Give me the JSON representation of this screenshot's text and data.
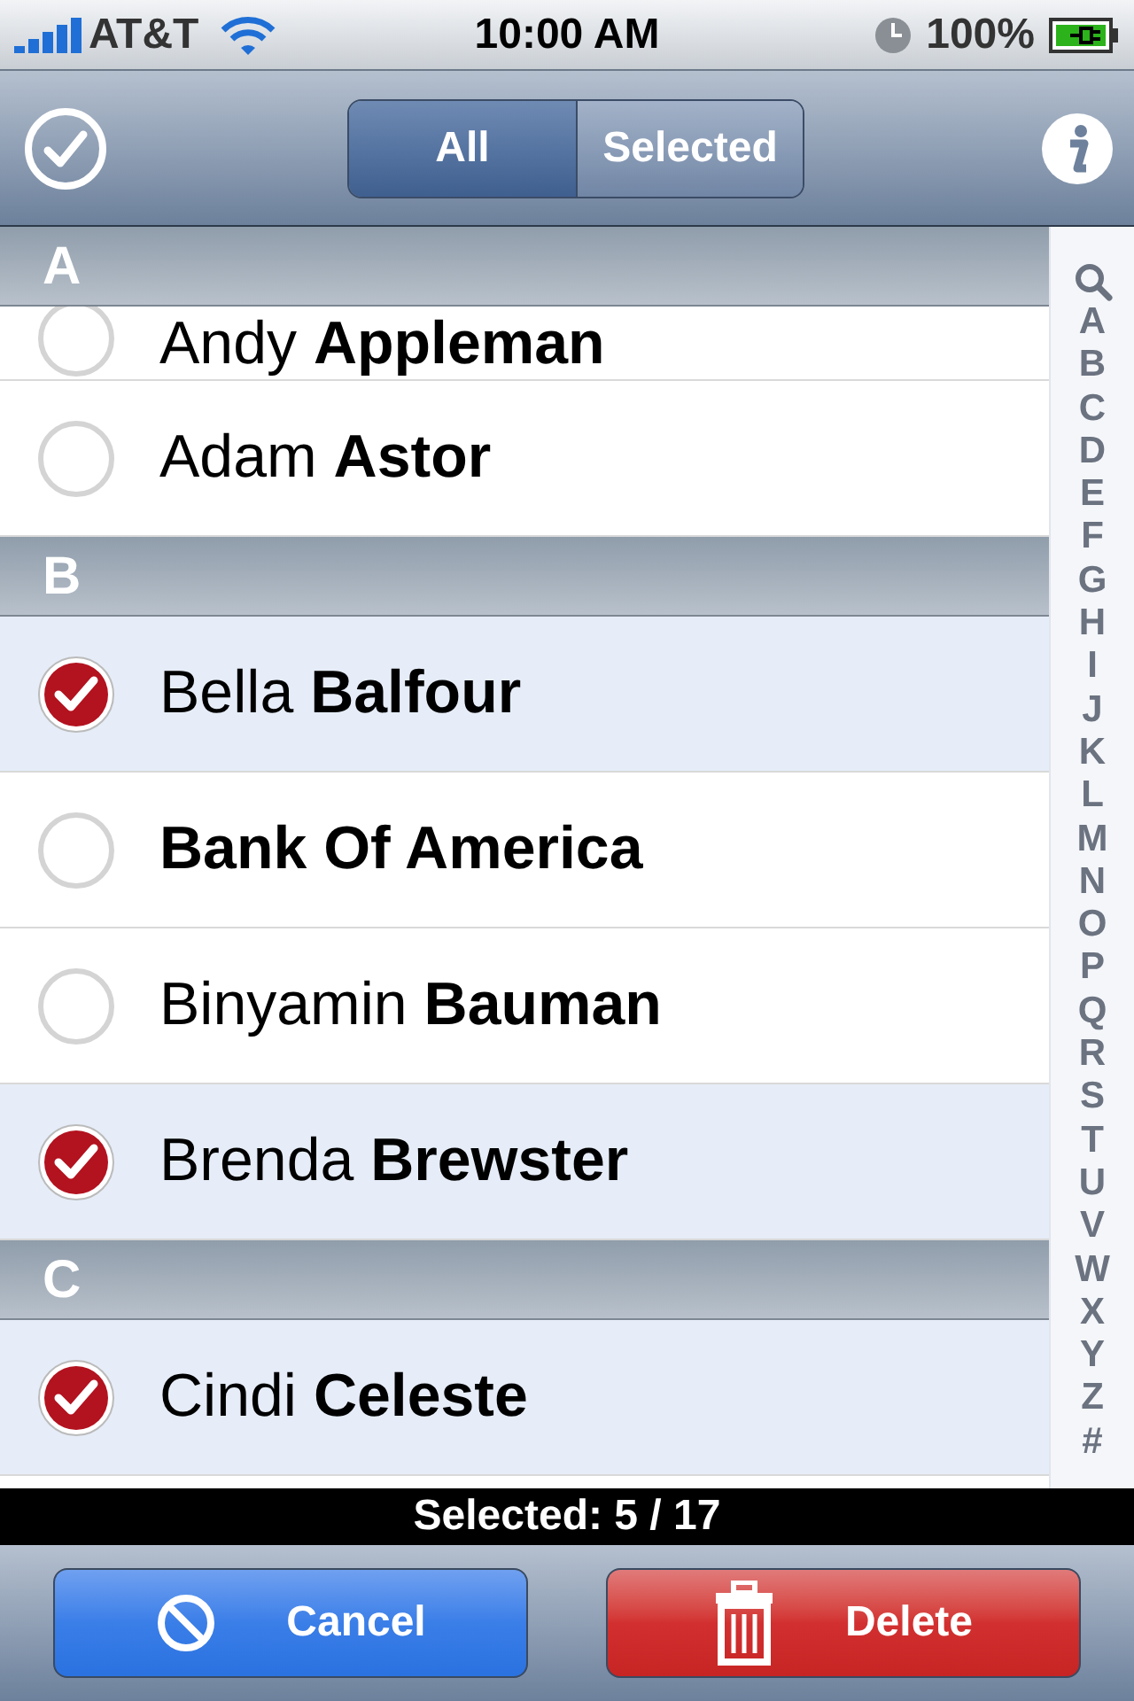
{
  "status_bar": {
    "carrier": "AT&T",
    "time": "10:00 AM",
    "battery": "100%"
  },
  "nav_bar": {
    "segments": [
      {
        "label": "All",
        "selected": true
      },
      {
        "label": "Selected",
        "selected": false
      }
    ]
  },
  "sections": [
    {
      "header": "A",
      "rows": [
        {
          "kind": "person",
          "first_name": "Andy",
          "last_name": "Appleman",
          "checked": false,
          "partial": true
        },
        {
          "kind": "person",
          "first_name": "Adam",
          "last_name": "Astor",
          "checked": false
        }
      ]
    },
    {
      "header": "B",
      "rows": [
        {
          "kind": "person",
          "first_name": "Bella",
          "last_name": "Balfour",
          "checked": true
        },
        {
          "kind": "company",
          "name": "Bank Of America",
          "checked": false
        },
        {
          "kind": "person",
          "first_name": "Binyamin",
          "last_name": "Bauman",
          "checked": false
        },
        {
          "kind": "person",
          "first_name": "Brenda",
          "last_name": "Brewster",
          "checked": true
        }
      ]
    },
    {
      "header": "C",
      "rows": [
        {
          "kind": "person",
          "first_name": "Cindi",
          "last_name": "Celeste",
          "checked": true
        }
      ]
    }
  ],
  "index": [
    "A",
    "B",
    "C",
    "D",
    "E",
    "F",
    "G",
    "H",
    "I",
    "J",
    "K",
    "L",
    "M",
    "N",
    "O",
    "P",
    "Q",
    "R",
    "S",
    "T",
    "U",
    "V",
    "W",
    "X",
    "Y",
    "Z",
    "#"
  ],
  "counter": "Selected: 5 / 17",
  "buttons": [
    {
      "kind": "cancel",
      "label": "Cancel"
    },
    {
      "kind": "delete",
      "label": "Delete"
    }
  ]
}
